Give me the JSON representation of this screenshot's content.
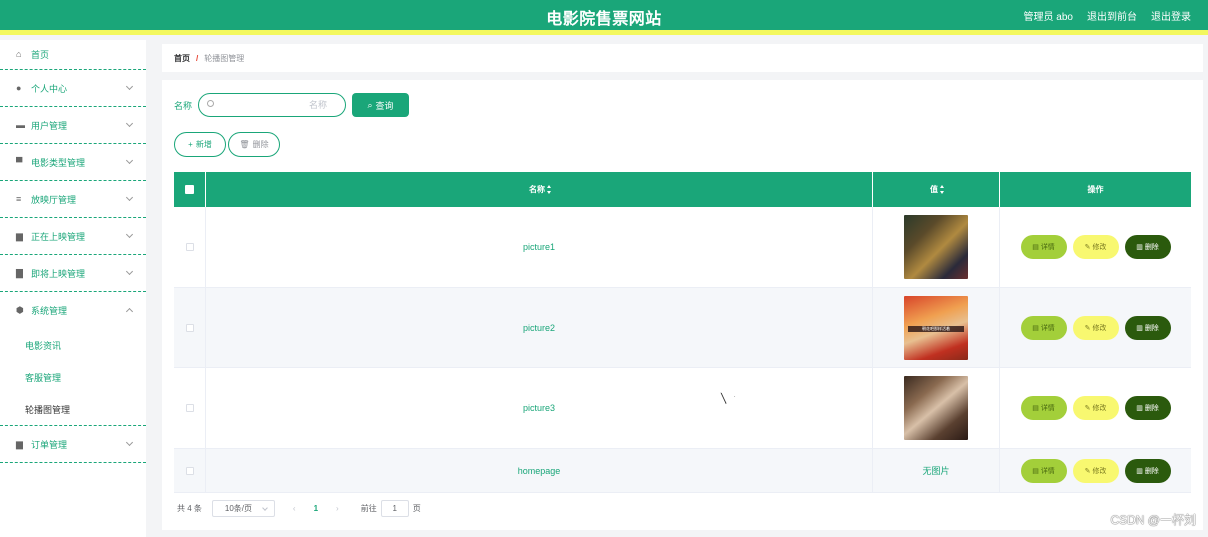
{
  "header": {
    "title": "电影院售票网站",
    "links": [
      "管理员 abo",
      "退出到前台",
      "退出登录"
    ]
  },
  "sidebar": {
    "items": [
      {
        "label": "首页",
        "icon": "home-icon"
      },
      {
        "label": "个人中心",
        "icon": "user-icon"
      },
      {
        "label": "用户管理",
        "icon": "chat-icon"
      },
      {
        "label": "电影类型管理",
        "icon": "monitor-icon"
      },
      {
        "label": "放映厅管理",
        "icon": "sliders-icon"
      },
      {
        "label": "正在上映管理",
        "icon": "film-icon"
      },
      {
        "label": "即将上映管理",
        "icon": "clipboard-icon"
      },
      {
        "label": "系统管理",
        "icon": "shield-icon"
      },
      {
        "label": "订单管理",
        "icon": "document-icon"
      }
    ],
    "system_sub": [
      "电影资讯",
      "客服管理",
      "轮播图管理"
    ]
  },
  "breadcrumb": {
    "home": "首页",
    "sep": "/",
    "current": "轮播图管理"
  },
  "search": {
    "label": "名称",
    "placeholder": "名称",
    "value": "",
    "query_label": "查询"
  },
  "actions": {
    "add_label": "新增",
    "delete_label": "删除"
  },
  "table": {
    "columns": [
      "名称",
      "值",
      "操作"
    ],
    "rows": [
      {
        "name": "picture1",
        "value": "",
        "image": "p1"
      },
      {
        "name": "picture2",
        "value": "",
        "image": "p2",
        "caption": "朝花吧那样活着"
      },
      {
        "name": "picture3",
        "value": "",
        "image": "p3"
      },
      {
        "name": "homepage",
        "value": "无图片"
      }
    ],
    "op_labels": {
      "detail": "详情",
      "edit": "修改",
      "delete": "删除"
    }
  },
  "pager": {
    "total": "共 4 条",
    "size": "10条/页",
    "prev": "‹",
    "page": "1",
    "next": "›",
    "goto": "前往",
    "goto_value": "1",
    "page_unit": "页"
  },
  "watermark": "CSDN @一杯刘",
  "colors": {
    "primary": "#1aa679",
    "accent_bar": "#f3f85f",
    "detail": "#a3cf3a",
    "edit": "#f8f870",
    "delete": "#2b5a0d"
  }
}
